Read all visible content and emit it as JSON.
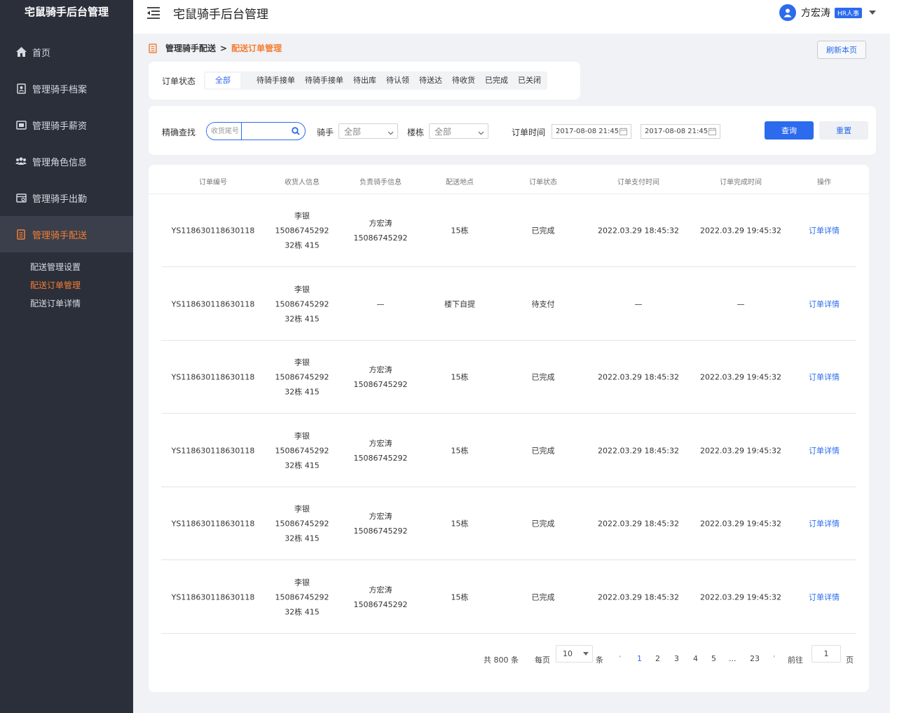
{
  "app": {
    "logo_text": "宅鼠骑手后台管理",
    "header_title": "宅鼠骑手后台管理"
  },
  "user": {
    "name": "方宏涛",
    "badge": "HR人事"
  },
  "sidebar": {
    "items": [
      {
        "label": "首页",
        "icon": "home-icon"
      },
      {
        "label": "管理骑手档案",
        "icon": "profile-icon"
      },
      {
        "label": "管理骑手薪资",
        "icon": "salary-icon"
      },
      {
        "label": "管理角色信息",
        "icon": "people-icon"
      },
      {
        "label": "管理骑手出勤",
        "icon": "attendance-icon"
      },
      {
        "label": "管理骑手配送",
        "icon": "document-icon"
      }
    ],
    "sub_items": [
      {
        "label": "配送管理设置"
      },
      {
        "label": "配送订单管理"
      },
      {
        "label": "配送订单详情"
      }
    ]
  },
  "breadcrumb": {
    "parent": "管理骑手配送",
    "separator": ">",
    "current": "配送订单管理"
  },
  "refresh_label": "刷新本页",
  "status": {
    "label": "订单状态",
    "tabs": [
      "全部",
      "待骑手接单",
      "待骑手接单",
      "待出库",
      "待认领",
      "待送达",
      "待收货",
      "已完成",
      "已关闭"
    ]
  },
  "filter": {
    "exact_label": "精确查找",
    "search_placeholder": "收货尾号",
    "rider_label": "骑手",
    "rider_value": "全部",
    "building_label": "楼栋",
    "building_value": "全部",
    "time_label": "订单时间",
    "date_start": "2017-08-08 21:45",
    "date_end": "2017-08-08 21:45",
    "query_label": "查询",
    "reset_label": "重置"
  },
  "table": {
    "headers": [
      "订单编号",
      "收货人信息",
      "负责骑手信息",
      "配送地点",
      "订单状态",
      "订单支付时间",
      "订单完成时间",
      "操作"
    ],
    "rows": [
      {
        "order_id": "YS118630118630118",
        "receiver_name": "李银",
        "receiver_phone": "15086745292",
        "receiver_addr": "32栋 415",
        "rider_name": "方宏涛",
        "rider_phone": "15086745292",
        "location": "15栋",
        "status": "已完成",
        "pay_time": "2022.03.29 18:45:32",
        "done_time": "2022.03.29 19:45:32",
        "action": "订单详情"
      },
      {
        "order_id": "YS118630118630118",
        "receiver_name": "李银",
        "receiver_phone": "15086745292",
        "receiver_addr": "32栋 415",
        "rider_name": "—",
        "rider_phone": "",
        "location": "楼下自提",
        "status": "待支付",
        "pay_time": "—",
        "done_time": "—",
        "action": "订单详情"
      },
      {
        "order_id": "YS118630118630118",
        "receiver_name": "李银",
        "receiver_phone": "15086745292",
        "receiver_addr": "32栋 415",
        "rider_name": "方宏涛",
        "rider_phone": "15086745292",
        "location": "15栋",
        "status": "已完成",
        "pay_time": "2022.03.29 18:45:32",
        "done_time": "2022.03.29 19:45:32",
        "action": "订单详情"
      },
      {
        "order_id": "YS118630118630118",
        "receiver_name": "李银",
        "receiver_phone": "15086745292",
        "receiver_addr": "32栋 415",
        "rider_name": "方宏涛",
        "rider_phone": "15086745292",
        "location": "15栋",
        "status": "已完成",
        "pay_time": "2022.03.29 18:45:32",
        "done_time": "2022.03.29 19:45:32",
        "action": "订单详情"
      },
      {
        "order_id": "YS118630118630118",
        "receiver_name": "李银",
        "receiver_phone": "15086745292",
        "receiver_addr": "32栋 415",
        "rider_name": "方宏涛",
        "rider_phone": "15086745292",
        "location": "15栋",
        "status": "已完成",
        "pay_time": "2022.03.29 18:45:32",
        "done_time": "2022.03.29 19:45:32",
        "action": "订单详情"
      },
      {
        "order_id": "YS118630118630118",
        "receiver_name": "李银",
        "receiver_phone": "15086745292",
        "receiver_addr": "32栋 415",
        "rider_name": "方宏涛",
        "rider_phone": "15086745292",
        "location": "15栋",
        "status": "已完成",
        "pay_time": "2022.03.29 18:45:32",
        "done_time": "2022.03.29 19:45:32",
        "action": "订单详情"
      }
    ]
  },
  "pagination": {
    "total_text": "共 800 条",
    "per_page_label": "每页",
    "per_page_value": "10",
    "per_page_unit": "条",
    "prev": "‘",
    "pages": [
      "1",
      "2",
      "3",
      "4",
      "5",
      "...",
      "23"
    ],
    "next": "’",
    "goto_label": "前往",
    "goto_value": "1",
    "goto_unit": "页"
  },
  "colors": {
    "accent": "#2c6bed",
    "highlight": "#f57e34",
    "sidebar_bg": "#2b2f3a"
  }
}
